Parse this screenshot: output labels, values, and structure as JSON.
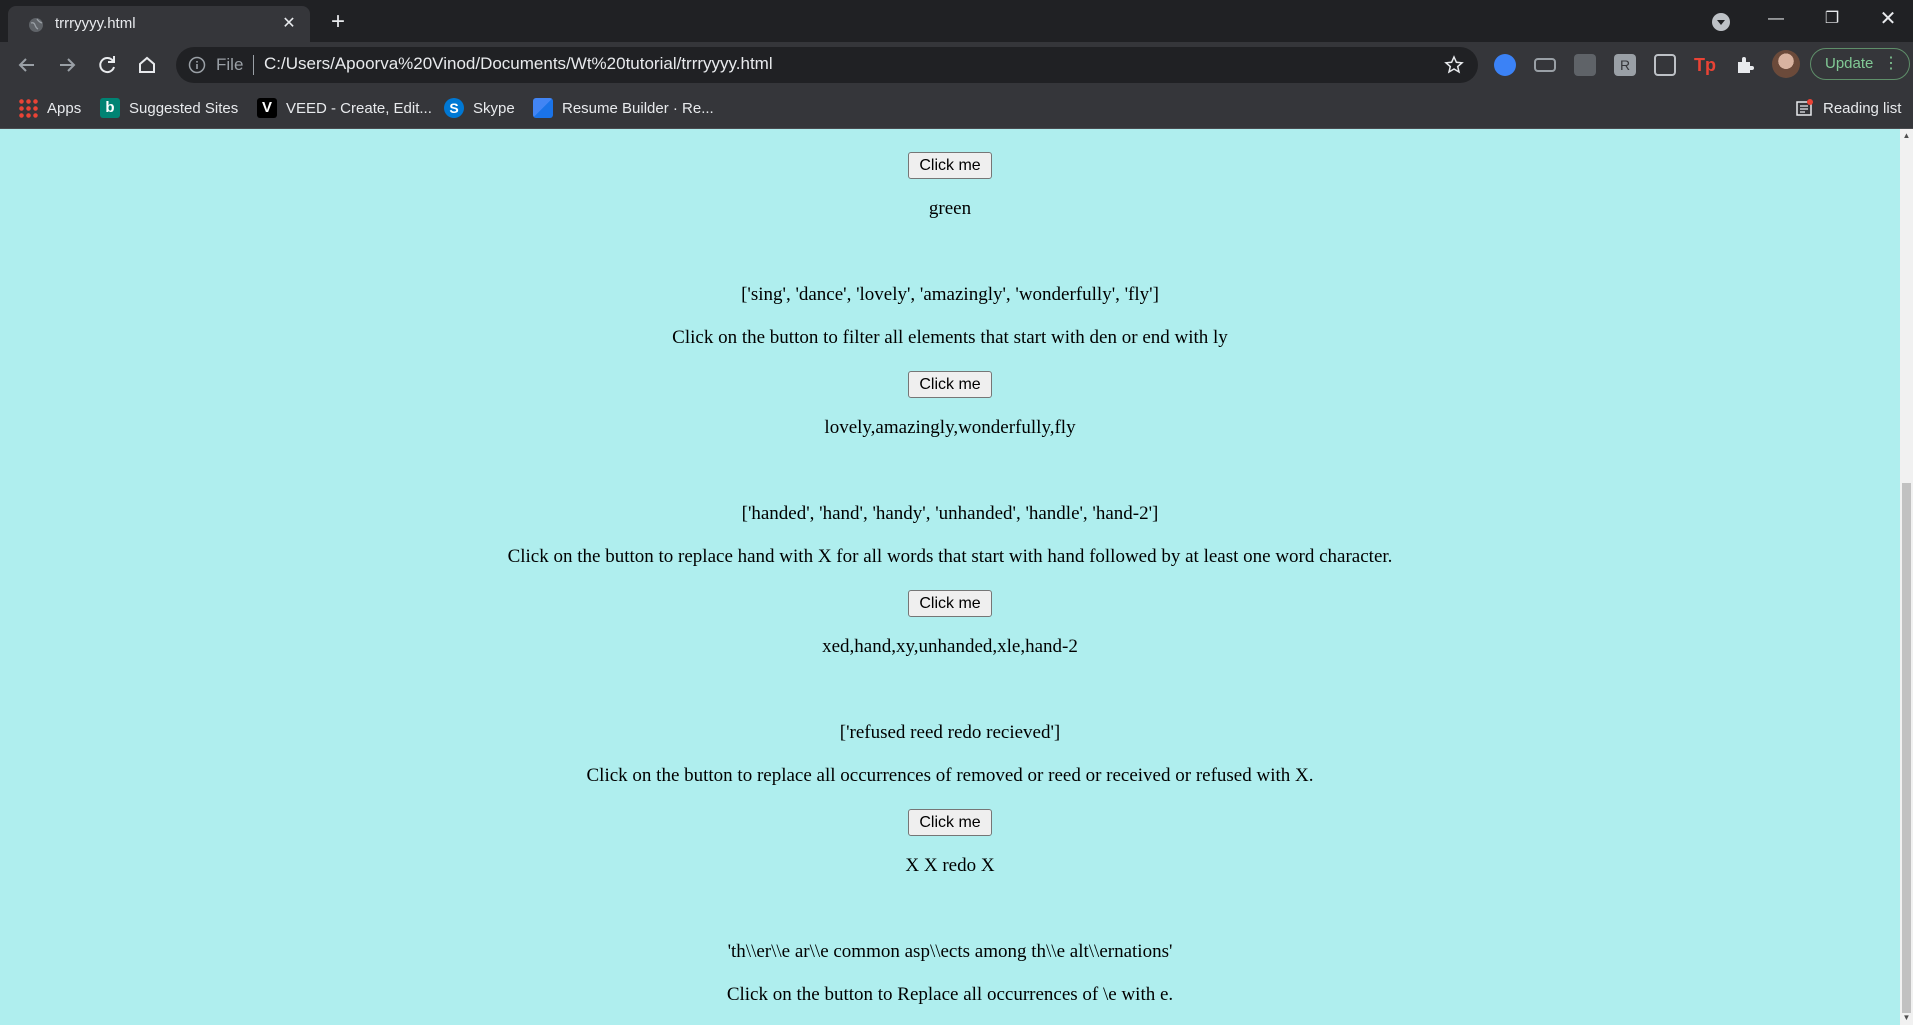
{
  "browser": {
    "tab_title": "trrryyyy.html",
    "address_prefix": "File",
    "url": "C:/Users/Apoorva%20Vinod/Documents/Wt%20tutorial/trrryyyy.html",
    "update_label": "Update",
    "reading_list_label": "Reading list",
    "bookmarks": [
      {
        "label": "Apps",
        "icon": "apps-grid-icon"
      },
      {
        "label": "Suggested Sites",
        "icon": "bing-icon"
      },
      {
        "label": "VEED - Create, Edit...",
        "icon": "veed-icon"
      },
      {
        "label": "Skype",
        "icon": "skype-icon"
      },
      {
        "label": "Resume Builder · Re...",
        "icon": "resume-builder-icon"
      }
    ]
  },
  "page": {
    "background_color": "#afeeee",
    "button_label": "Click me",
    "section1": {
      "result": "green"
    },
    "section2": {
      "array": "['sing', 'dance', 'lovely', 'amazingly', 'wonderfully', 'fly']",
      "instruction": "Click on the button to filter all elements that start with den or end with ly",
      "result": "lovely,amazingly,wonderfully,fly"
    },
    "section3": {
      "array": "['handed', 'hand', 'handy', 'unhanded', 'handle', 'hand-2']",
      "instruction": "Click on the button to replace hand with X for all words that start with hand followed by at least one word character.",
      "result": "xed,hand,xy,unhanded,xle,hand-2"
    },
    "section4": {
      "array": "['refused reed redo recieved']",
      "instruction": "Click on the button to replace all occurrences of removed or reed or received or refused with X.",
      "result": "X X redo X"
    },
    "section5": {
      "array": "'th\\\\er\\\\e ar\\\\e common asp\\\\ects among th\\\\e alt\\\\ernations'",
      "instruction": "Click on the button to Replace all occurrences of \\e with e."
    }
  }
}
